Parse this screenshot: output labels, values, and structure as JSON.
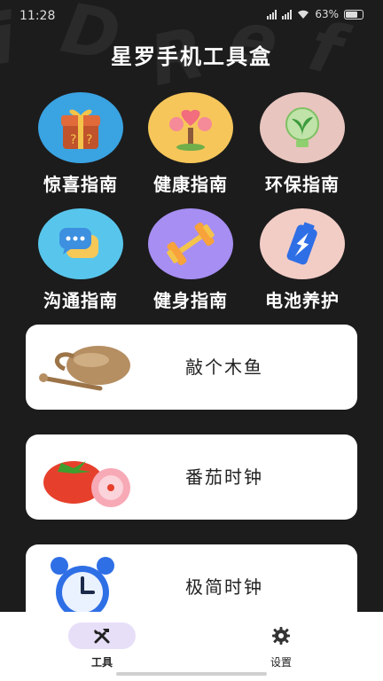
{
  "status_bar": {
    "time": "11:28",
    "battery": "63%"
  },
  "app_title": "星罗手机工具盒",
  "guides": [
    {
      "label": "惊喜指南",
      "icon": "gift-box-icon",
      "color": "#3aa3e2"
    },
    {
      "label": "健康指南",
      "icon": "heart-tree-icon",
      "color": "#f6c65a"
    },
    {
      "label": "环保指南",
      "icon": "green-bulb-icon",
      "color": "#e8c5bf"
    },
    {
      "label": "沟通指南",
      "icon": "chat-bubble-icon",
      "color": "#58c6ec"
    },
    {
      "label": "健身指南",
      "icon": "dumbbell-icon",
      "color": "#a78ef3"
    },
    {
      "label": "电池养护",
      "icon": "battery-icon",
      "color": "#f2cdc6"
    }
  ],
  "tools": [
    {
      "label": "敲个木鱼",
      "icon": "wooden-fish-icon"
    },
    {
      "label": "番茄时钟",
      "icon": "tomato-icon"
    },
    {
      "label": "极简时钟",
      "icon": "alarm-clock-icon"
    }
  ],
  "tabs": [
    {
      "label": "工具",
      "icon": "tools-icon",
      "active": true
    },
    {
      "label": "设置",
      "icon": "settings-gear-icon",
      "active": false
    }
  ],
  "colors": {
    "background": "#1c1c1c",
    "card": "#ffffff",
    "active_tab": "#e7dff8"
  }
}
